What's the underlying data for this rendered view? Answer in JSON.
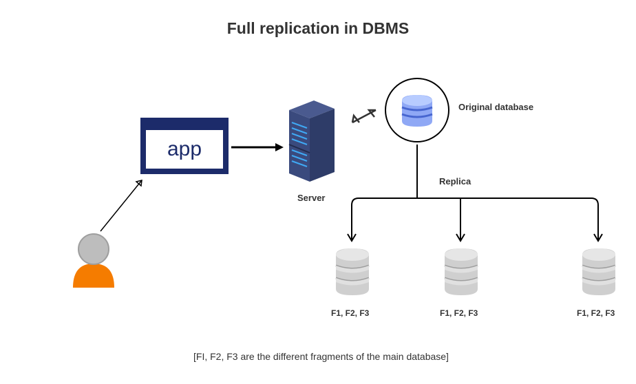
{
  "title": "Full replication in DBMS",
  "app_label": "app",
  "server_label": "Server",
  "original_db_label": "Original database",
  "replica_label": "Replica",
  "replica_fragments": {
    "a": "F1, F2, F3",
    "b": "F1, F2, F3",
    "c": "F1, F2, F3"
  },
  "caption": "[FI, F2, F3 are the different fragments of the main database]",
  "colors": {
    "user_body": "#f57c00",
    "user_head": "#bdbdbd",
    "user_head_stroke": "#9e9e9e",
    "monitor_frame": "#1c2b6a",
    "server_dark": "#2e3c68",
    "server_light": "#4a5a8f",
    "server_blue": "#3fa9f5",
    "db_blue_light": "#a8c1ff",
    "db_blue_mid": "#6e8fed",
    "db_blue_dark": "#4766d0",
    "db_gray_light": "#d9d9d9",
    "db_gray_mid": "#bfbfbf",
    "db_gray_dark": "#9e9e9e"
  }
}
